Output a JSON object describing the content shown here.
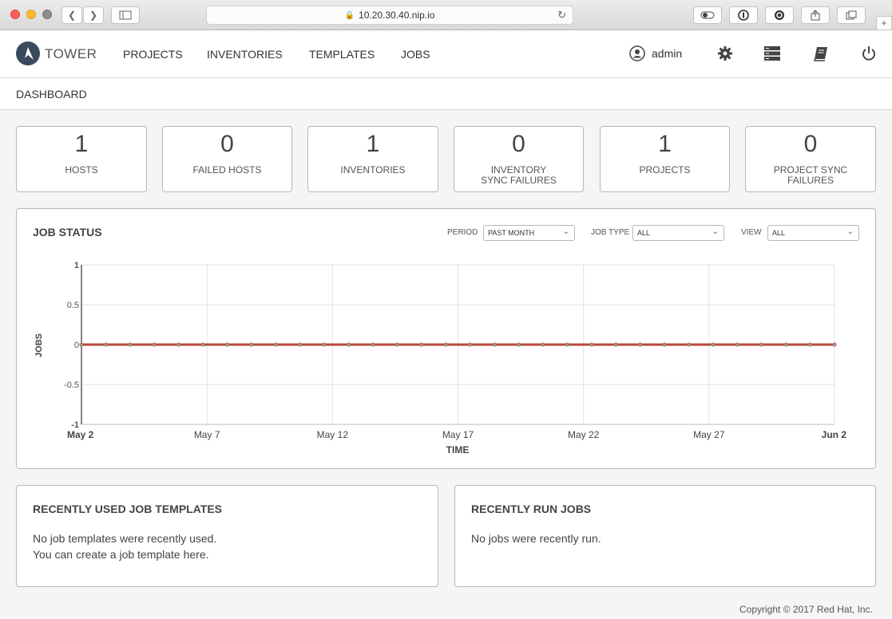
{
  "browser": {
    "url": "10.20.30.40.nip.io"
  },
  "nav": {
    "brand": "TOWER",
    "links": [
      "PROJECTS",
      "INVENTORIES",
      "TEMPLATES",
      "JOBS"
    ],
    "user": "admin"
  },
  "breadcrumb": "DASHBOARD",
  "counts": [
    {
      "value": "1",
      "label": "HOSTS"
    },
    {
      "value": "0",
      "label": "FAILED HOSTS"
    },
    {
      "value": "1",
      "label": "INVENTORIES"
    },
    {
      "value": "0",
      "label": "INVENTORY SYNC FAILURES"
    },
    {
      "value": "1",
      "label": "PROJECTS"
    },
    {
      "value": "0",
      "label": "PROJECT SYNC FAILURES"
    }
  ],
  "job_status": {
    "title": "JOB STATUS",
    "period_label": "PERIOD",
    "period_value": "PAST MONTH",
    "job_type_label": "JOB TYPE",
    "job_type_value": "ALL",
    "view_label": "VIEW",
    "view_value": "ALL"
  },
  "chart_data": {
    "type": "line",
    "xlabel": "TIME",
    "ylabel": "JOBS",
    "ylim": [
      -1,
      1
    ],
    "yticks": [
      "1",
      "0.5",
      "0",
      "-0.5",
      "-1"
    ],
    "xticks": [
      "May 2",
      "May 7",
      "May 12",
      "May 17",
      "May 22",
      "May 27",
      "Jun 2"
    ],
    "grid": true,
    "series": [
      {
        "values": [
          0,
          0,
          0,
          0,
          0,
          0,
          0,
          0,
          0,
          0,
          0,
          0,
          0,
          0,
          0,
          0,
          0,
          0,
          0,
          0,
          0,
          0,
          0,
          0,
          0,
          0,
          0,
          0,
          0,
          0,
          0,
          0
        ],
        "color": "#b94a3a"
      }
    ]
  },
  "recent_templates": {
    "title": "RECENTLY USED JOB TEMPLATES",
    "line1": "No job templates were recently used.",
    "line2": "You can create a job template here."
  },
  "recent_jobs": {
    "title": "RECENTLY RUN JOBS",
    "line1": "No jobs were recently run."
  },
  "footer": "Copyright © 2017 Red Hat, Inc."
}
